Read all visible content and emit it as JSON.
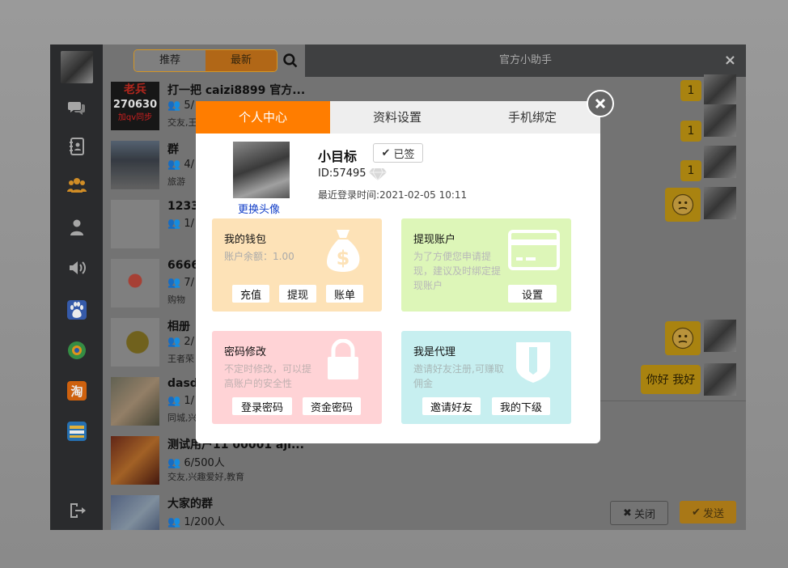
{
  "sidebar": {
    "icons": [
      "chat-icon",
      "contacts-book-icon",
      "group-icon",
      "user-icon",
      "speaker-icon",
      "baidu-icon",
      "video-icon",
      "taobao-icon",
      "wallet-icon",
      "logout-icon"
    ]
  },
  "list": {
    "seg_recommend": "推荐",
    "seg_latest": "最新",
    "items": [
      {
        "name": "打一把 caizi8899 官方...",
        "members": "5/",
        "tags": "交友,王"
      },
      {
        "name": "群",
        "members": "4/",
        "tags": "旅游"
      },
      {
        "name": "1233",
        "members": "1/",
        "tags": ""
      },
      {
        "name": "6666",
        "members": "7/",
        "tags": "购物"
      },
      {
        "name": "相册",
        "members": "2/",
        "tags": "王者荣"
      },
      {
        "name": "dasd",
        "members": "1/",
        "tags": "同城,兴"
      },
      {
        "name": "测试用户11 00001 aji...",
        "members": "6/500人",
        "tags": "交友,兴趣爱好,教育"
      },
      {
        "name": "大家的群",
        "members": "1/200人",
        "tags": ""
      }
    ],
    "avatar1_text_top": "老兵",
    "avatar1_text_num": "270630",
    "avatar1_text_bottom": "加qv同步"
  },
  "chat": {
    "title": "官方小助手",
    "close_symbol": "×",
    "bubbles": [
      "1",
      "1",
      "1"
    ],
    "last_message": "你好 我好",
    "close_button": "关闭",
    "send_button": "发送"
  },
  "modal": {
    "tabs": [
      "个人中心",
      "资料设置",
      "手机绑定"
    ],
    "change_avatar": "更换头像",
    "username": "小目标",
    "signed_label": "已签",
    "id_label": "ID:57495",
    "last_login": "最近登录时间:2021-02-05 10:11",
    "wallet": {
      "title": "我的钱包",
      "balance": "账户余额：1.00",
      "btn_recharge": "充值",
      "btn_withdraw": "提现",
      "btn_bill": "账单"
    },
    "withdraw_account": {
      "title": "提现账户",
      "desc": "为了方便您申请提现，建议及时绑定提现账户",
      "btn_settings": "设置"
    },
    "password": {
      "title": "密码修改",
      "desc": "不定时修改，可以提高账户的安全性",
      "btn_login_pw": "登录密码",
      "btn_fund_pw": "资金密码"
    },
    "agent": {
      "title": "我是代理",
      "desc": "邀请好友注册,可赚取佣金",
      "btn_invite": "邀请好友",
      "btn_subordinates": "我的下级"
    }
  },
  "colors": {
    "accent": "#ff7d00",
    "wallet_bg": "#fde2b7",
    "withdraw_bg": "#ddf6b8",
    "password_bg": "#ffd3d6",
    "agent_bg": "#c7eff0"
  }
}
